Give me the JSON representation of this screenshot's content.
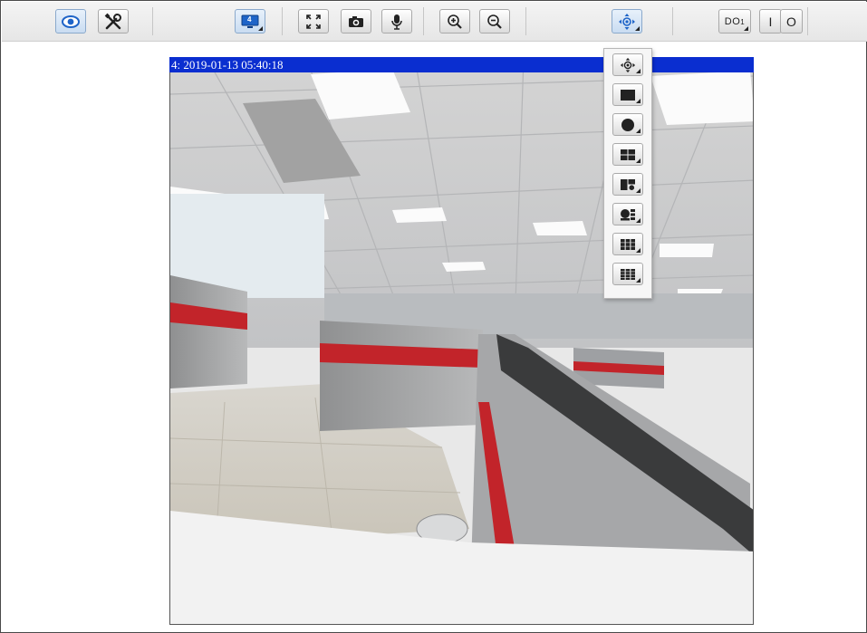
{
  "toolbar": {
    "buttons": [
      {
        "name": "live-view-icon",
        "active": true
      },
      {
        "name": "settings-tools-icon",
        "active": false
      },
      {
        "name": "display-mode-icon",
        "badge": "4",
        "active": true
      },
      {
        "name": "fullscreen-icon",
        "active": false
      },
      {
        "name": "snapshot-camera-icon",
        "active": false
      },
      {
        "name": "microphone-icon",
        "active": false
      },
      {
        "name": "zoom-in-icon",
        "active": false
      },
      {
        "name": "zoom-out-icon",
        "active": false
      },
      {
        "name": "ptz-move-icon",
        "active": true
      },
      {
        "name": "digital-output-icon",
        "label": "DO",
        "sub": "1"
      },
      {
        "name": "output-on-icon",
        "label": "I"
      },
      {
        "name": "output-off-icon",
        "label": "O"
      }
    ]
  },
  "video": {
    "osd_text": "4: 2019-01-13 05:40:18"
  },
  "layout_menu": {
    "items": [
      "ptz-move-icon",
      "single-view-icon",
      "fisheye-circle-icon",
      "quad-view-icon",
      "dual-panorama-icon",
      "fisheye-plus-views-icon",
      "grid-view-icon",
      "multi-grid-view-icon"
    ]
  },
  "colors": {
    "osd_bar": "#0a2ed0",
    "active_button": "#c9dcf1",
    "accent_blue": "#1e64c8"
  }
}
